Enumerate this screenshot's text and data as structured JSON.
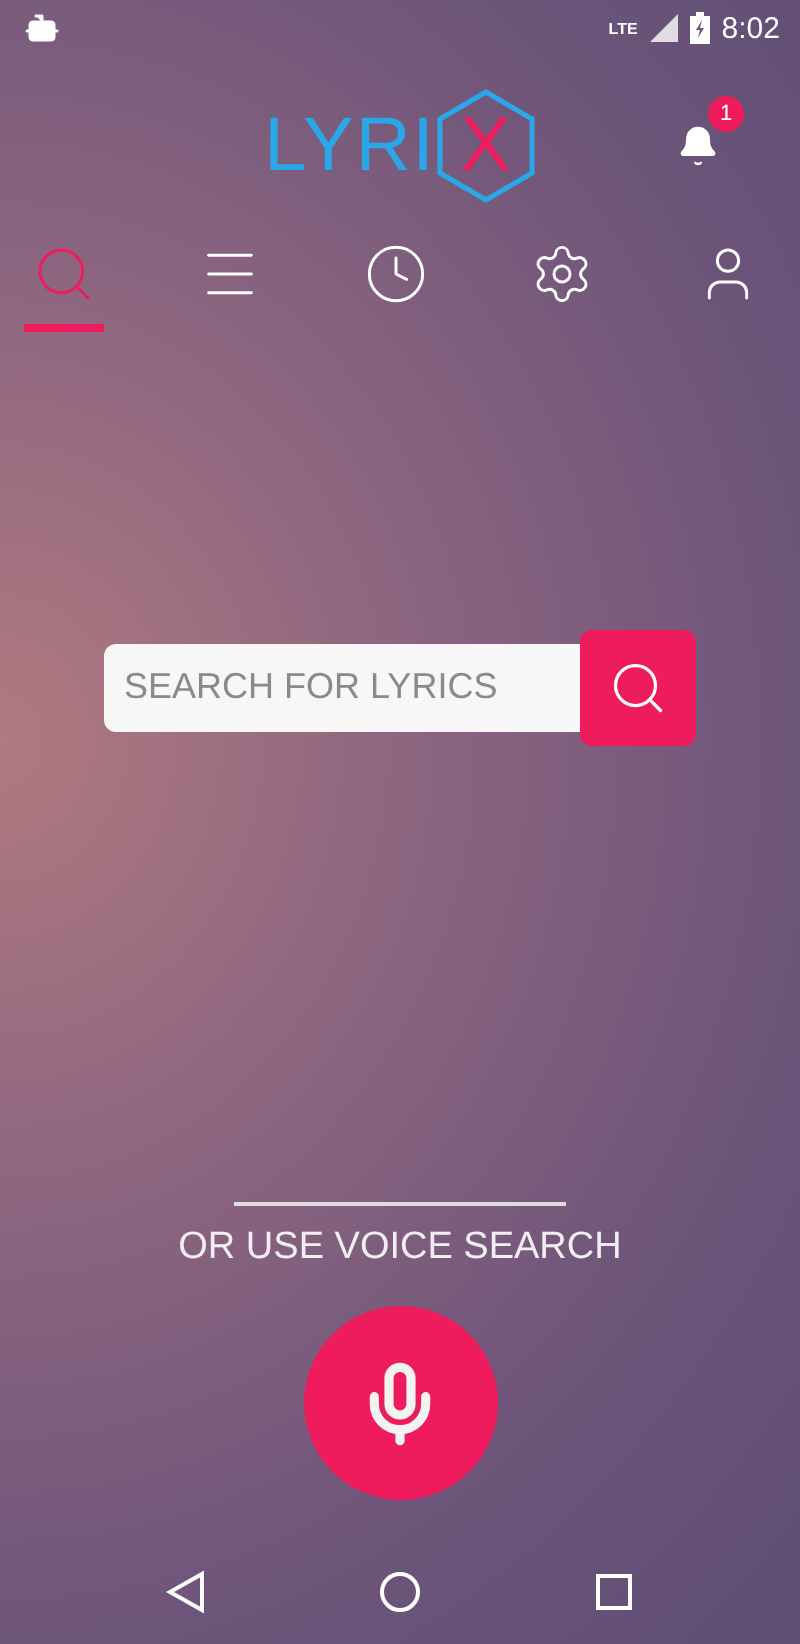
{
  "status_bar": {
    "network": "LTE",
    "time": "8:02"
  },
  "header": {
    "logo": {
      "text": "LYRI",
      "mark": "X"
    },
    "notifications": {
      "count": "1"
    }
  },
  "tabs": [
    {
      "kind": "search",
      "selected": true
    },
    {
      "kind": "menu",
      "selected": false
    },
    {
      "kind": "history",
      "selected": false
    },
    {
      "kind": "settings",
      "selected": false
    },
    {
      "kind": "profile",
      "selected": false
    }
  ],
  "search": {
    "placeholder": "SEARCH FOR LYRICS"
  },
  "voice": {
    "label": "OR USE VOICE SEARCH"
  }
}
